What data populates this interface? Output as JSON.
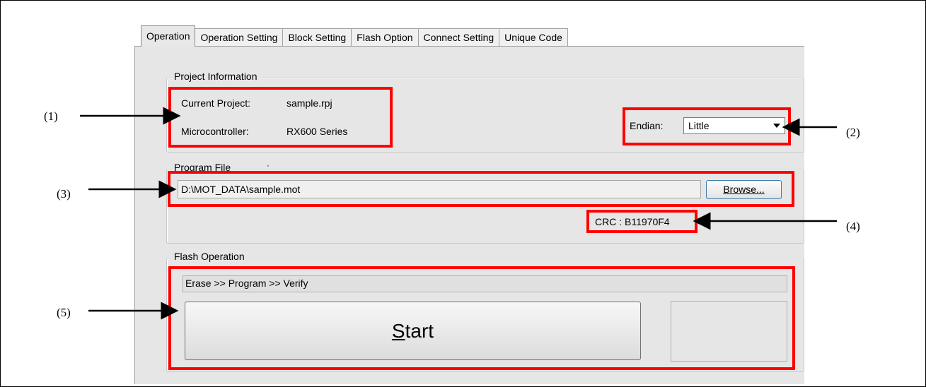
{
  "tabs": [
    {
      "label": "Operation",
      "active": true
    },
    {
      "label": "Operation Setting"
    },
    {
      "label": "Block Setting"
    },
    {
      "label": "Flash Option"
    },
    {
      "label": "Connect Setting"
    },
    {
      "label": "Unique Code"
    }
  ],
  "project_info": {
    "legend": "Project Information",
    "current_project_label": "Current Project:",
    "current_project_value": "sample.rpj",
    "microcontroller_label": "Microcontroller:",
    "microcontroller_value": "RX600 Series",
    "endian_label": "Endian:",
    "endian_value": "Little"
  },
  "program_file": {
    "legend": "Program File",
    "path": "D:\\MOT_DATA\\sample.mot",
    "browse_label": "Browse...",
    "crc": "CRC : B11970F4"
  },
  "flash_operation": {
    "legend": "Flash Operation",
    "sequence": "Erase >> Program >> Verify",
    "start_first": "S",
    "start_rest": "tart"
  },
  "callouts": [
    "(1)",
    "(2)",
    "(3)",
    "(4)",
    "(5)"
  ],
  "colors": {
    "highlight": "#ff0000",
    "panel": "#e6e6e6"
  }
}
